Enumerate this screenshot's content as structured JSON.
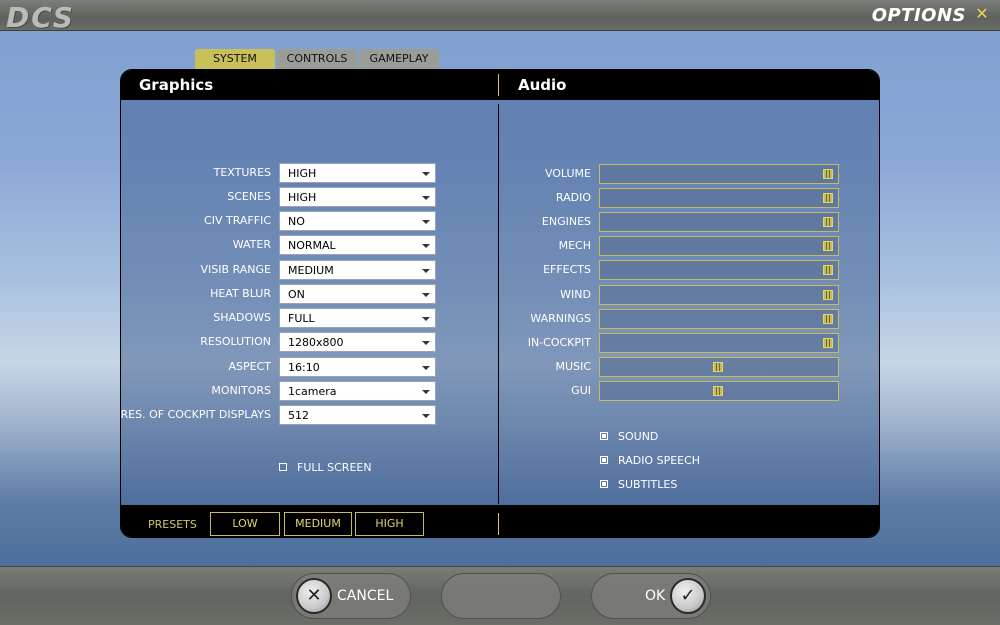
{
  "window": {
    "logo": "DCS",
    "title": "OPTIONS",
    "close_glyph": "✕"
  },
  "tabs": [
    {
      "label": "SYSTEM",
      "active": true
    },
    {
      "label": "CONTROLS",
      "active": false
    },
    {
      "label": "GAMEPLAY",
      "active": false
    }
  ],
  "graphics": {
    "heading": "Graphics",
    "settings": [
      {
        "label": "TEXTURES",
        "value": "HIGH"
      },
      {
        "label": "SCENES",
        "value": "HIGH"
      },
      {
        "label": "CIV TRAFFIC",
        "value": "NO"
      },
      {
        "label": "WATER",
        "value": "NORMAL"
      },
      {
        "label": "VISIB RANGE",
        "value": "MEDIUM"
      },
      {
        "label": "HEAT BLUR",
        "value": "ON"
      },
      {
        "label": "SHADOWS",
        "value": "FULL"
      },
      {
        "label": "RESOLUTION",
        "value": "1280x800"
      },
      {
        "label": "ASPECT",
        "value": "16:10"
      },
      {
        "label": "MONITORS",
        "value": "1camera"
      },
      {
        "label": "RES. OF COCKPIT DISPLAYS",
        "value": "512"
      }
    ],
    "full_screen": {
      "label": "FULL SCREEN",
      "checked": false
    }
  },
  "audio": {
    "heading": "Audio",
    "sliders": [
      {
        "label": "VOLUME",
        "level": 1.0
      },
      {
        "label": "RADIO",
        "level": 1.0
      },
      {
        "label": "ENGINES",
        "level": 1.0
      },
      {
        "label": "MECH",
        "level": 1.0
      },
      {
        "label": "EFFECTS",
        "level": 1.0
      },
      {
        "label": "WIND",
        "level": 1.0
      },
      {
        "label": "WARNINGS",
        "level": 1.0
      },
      {
        "label": "IN-COCKPIT",
        "level": 1.0
      },
      {
        "label": "MUSIC",
        "level": 0.5
      },
      {
        "label": "GUI",
        "level": 0.5
      }
    ],
    "checks": [
      {
        "label": "SOUND",
        "checked": true
      },
      {
        "label": "RADIO SPEECH",
        "checked": true
      },
      {
        "label": "SUBTITLES",
        "checked": true
      }
    ]
  },
  "presets": {
    "label": "PRESETS",
    "buttons": [
      "LOW",
      "MEDIUM",
      "HIGH"
    ]
  },
  "footer": {
    "cancel_label": "CANCEL",
    "cancel_glyph": "✕",
    "ok_label": "OK",
    "ok_glyph": "✓"
  },
  "colors": {
    "accent": "#c9c05a",
    "panel_header": "#000000"
  }
}
